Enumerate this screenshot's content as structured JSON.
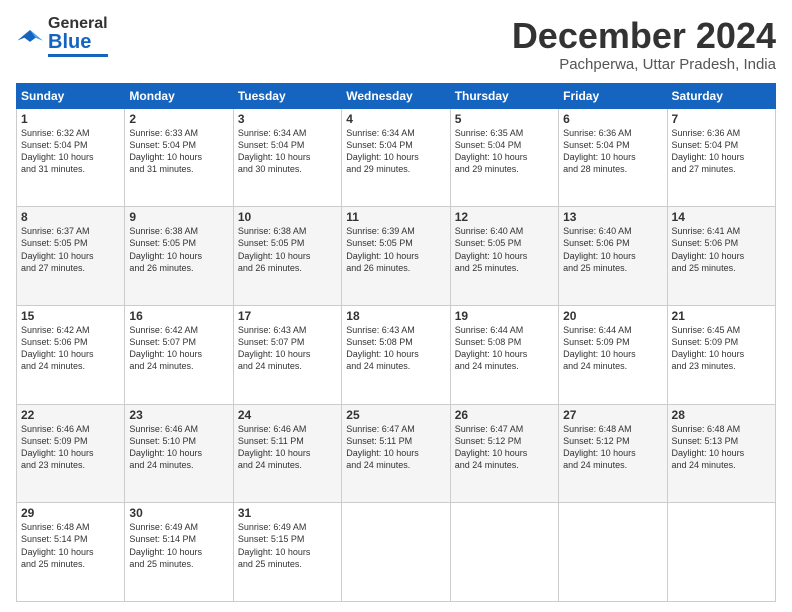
{
  "header": {
    "logo": {
      "general": "General",
      "blue": "Blue"
    },
    "title": "December 2024",
    "location": "Pachperwa, Uttar Pradesh, India"
  },
  "weekdays": [
    "Sunday",
    "Monday",
    "Tuesday",
    "Wednesday",
    "Thursday",
    "Friday",
    "Saturday"
  ],
  "weeks": [
    [
      {
        "day": "1",
        "info": "Sunrise: 6:32 AM\nSunset: 5:04 PM\nDaylight: 10 hours\nand 31 minutes."
      },
      {
        "day": "2",
        "info": "Sunrise: 6:33 AM\nSunset: 5:04 PM\nDaylight: 10 hours\nand 31 minutes."
      },
      {
        "day": "3",
        "info": "Sunrise: 6:34 AM\nSunset: 5:04 PM\nDaylight: 10 hours\nand 30 minutes."
      },
      {
        "day": "4",
        "info": "Sunrise: 6:34 AM\nSunset: 5:04 PM\nDaylight: 10 hours\nand 29 minutes."
      },
      {
        "day": "5",
        "info": "Sunrise: 6:35 AM\nSunset: 5:04 PM\nDaylight: 10 hours\nand 29 minutes."
      },
      {
        "day": "6",
        "info": "Sunrise: 6:36 AM\nSunset: 5:04 PM\nDaylight: 10 hours\nand 28 minutes."
      },
      {
        "day": "7",
        "info": "Sunrise: 6:36 AM\nSunset: 5:04 PM\nDaylight: 10 hours\nand 27 minutes."
      }
    ],
    [
      {
        "day": "8",
        "info": "Sunrise: 6:37 AM\nSunset: 5:05 PM\nDaylight: 10 hours\nand 27 minutes."
      },
      {
        "day": "9",
        "info": "Sunrise: 6:38 AM\nSunset: 5:05 PM\nDaylight: 10 hours\nand 26 minutes."
      },
      {
        "day": "10",
        "info": "Sunrise: 6:38 AM\nSunset: 5:05 PM\nDaylight: 10 hours\nand 26 minutes."
      },
      {
        "day": "11",
        "info": "Sunrise: 6:39 AM\nSunset: 5:05 PM\nDaylight: 10 hours\nand 26 minutes."
      },
      {
        "day": "12",
        "info": "Sunrise: 6:40 AM\nSunset: 5:05 PM\nDaylight: 10 hours\nand 25 minutes."
      },
      {
        "day": "13",
        "info": "Sunrise: 6:40 AM\nSunset: 5:06 PM\nDaylight: 10 hours\nand 25 minutes."
      },
      {
        "day": "14",
        "info": "Sunrise: 6:41 AM\nSunset: 5:06 PM\nDaylight: 10 hours\nand 25 minutes."
      }
    ],
    [
      {
        "day": "15",
        "info": "Sunrise: 6:42 AM\nSunset: 5:06 PM\nDaylight: 10 hours\nand 24 minutes."
      },
      {
        "day": "16",
        "info": "Sunrise: 6:42 AM\nSunset: 5:07 PM\nDaylight: 10 hours\nand 24 minutes."
      },
      {
        "day": "17",
        "info": "Sunrise: 6:43 AM\nSunset: 5:07 PM\nDaylight: 10 hours\nand 24 minutes."
      },
      {
        "day": "18",
        "info": "Sunrise: 6:43 AM\nSunset: 5:08 PM\nDaylight: 10 hours\nand 24 minutes."
      },
      {
        "day": "19",
        "info": "Sunrise: 6:44 AM\nSunset: 5:08 PM\nDaylight: 10 hours\nand 24 minutes."
      },
      {
        "day": "20",
        "info": "Sunrise: 6:44 AM\nSunset: 5:09 PM\nDaylight: 10 hours\nand 24 minutes."
      },
      {
        "day": "21",
        "info": "Sunrise: 6:45 AM\nSunset: 5:09 PM\nDaylight: 10 hours\nand 23 minutes."
      }
    ],
    [
      {
        "day": "22",
        "info": "Sunrise: 6:46 AM\nSunset: 5:09 PM\nDaylight: 10 hours\nand 23 minutes."
      },
      {
        "day": "23",
        "info": "Sunrise: 6:46 AM\nSunset: 5:10 PM\nDaylight: 10 hours\nand 24 minutes."
      },
      {
        "day": "24",
        "info": "Sunrise: 6:46 AM\nSunset: 5:11 PM\nDaylight: 10 hours\nand 24 minutes."
      },
      {
        "day": "25",
        "info": "Sunrise: 6:47 AM\nSunset: 5:11 PM\nDaylight: 10 hours\nand 24 minutes."
      },
      {
        "day": "26",
        "info": "Sunrise: 6:47 AM\nSunset: 5:12 PM\nDaylight: 10 hours\nand 24 minutes."
      },
      {
        "day": "27",
        "info": "Sunrise: 6:48 AM\nSunset: 5:12 PM\nDaylight: 10 hours\nand 24 minutes."
      },
      {
        "day": "28",
        "info": "Sunrise: 6:48 AM\nSunset: 5:13 PM\nDaylight: 10 hours\nand 24 minutes."
      }
    ],
    [
      {
        "day": "29",
        "info": "Sunrise: 6:48 AM\nSunset: 5:14 PM\nDaylight: 10 hours\nand 25 minutes."
      },
      {
        "day": "30",
        "info": "Sunrise: 6:49 AM\nSunset: 5:14 PM\nDaylight: 10 hours\nand 25 minutes."
      },
      {
        "day": "31",
        "info": "Sunrise: 6:49 AM\nSunset: 5:15 PM\nDaylight: 10 hours\nand 25 minutes."
      },
      {
        "day": "",
        "info": ""
      },
      {
        "day": "",
        "info": ""
      },
      {
        "day": "",
        "info": ""
      },
      {
        "day": "",
        "info": ""
      }
    ]
  ]
}
